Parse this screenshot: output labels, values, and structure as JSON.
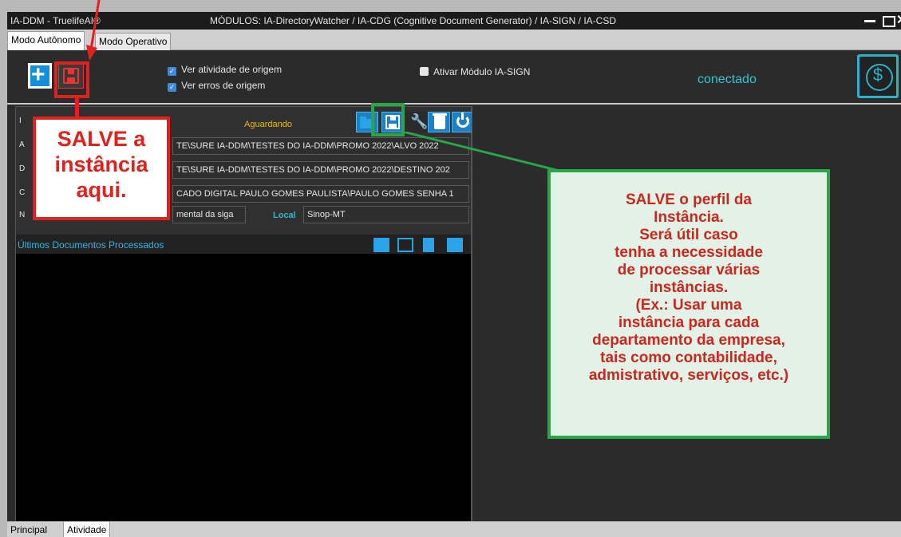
{
  "titlebar": {
    "app_title": "IA-DDM  -  TruelifeAI®",
    "modules": "MÓDULOS:  IA-DirectoryWatcher / IA-CDG (Cognitive Document Generator) / IA-SIGN / IA-CSD",
    "close_glyph": "✕"
  },
  "tabs_top": [
    "Modo Autônomo",
    "Modo Operativo"
  ],
  "toolbar": {
    "check_activity": "Ver atividade de origem",
    "check_errors": "Ver erros de origem",
    "check_sign": "Ativar Módulo IA-SIGN",
    "connection_status": "conectado",
    "dollar_symbol": "$"
  },
  "instance": {
    "status": "Aguardando",
    "side_letters": [
      "I",
      "A",
      "D",
      "C",
      "N"
    ],
    "field_origin": "TE\\SURE IA-DDM\\TESTES DO IA-DDM\\PROMO 2022\\ALVO 2022",
    "field_destination": "TE\\SURE IA-DDM\\TESTES DO IA-DDM\\PROMO 2022\\DESTINO 202",
    "field_certificate": "CADO DIGITAL PAULO GOMES PAULISTA\\PAULO GOMES SENHA 1",
    "field_name": "mental da siga",
    "local_label": "Local",
    "local_value": "Sinop-MT"
  },
  "docs": {
    "title": "Últimos Documentos Processados"
  },
  "tabs_bottom": [
    "Principal",
    "Atividade"
  ],
  "callouts": {
    "red_lines": [
      "SALVE a",
      "instância",
      "aqui."
    ],
    "green_lines": [
      "SALVE o perfil da",
      "Instância.",
      "Será útil caso",
      "tenha a necessidade",
      "de processar várias",
      "instâncias.",
      "(Ex.: Usar uma",
      "instância para cada",
      "departamento da empresa,",
      "tais como contabilidade,",
      "admistrativo, serviços, etc.)"
    ]
  },
  "colors": {
    "accent_cyan": "#37c3d4",
    "status_yellow": "#e7b81f",
    "callout_red": "#e0221c",
    "callout_green": "#2aa54a"
  },
  "icons": [
    "plus-icon",
    "floppy-save-icon",
    "folder-icon",
    "wrench-icon",
    "trash-icon",
    "power-icon",
    "dollar-icon",
    "close-icon",
    "minimize-icon",
    "maximize-icon"
  ]
}
